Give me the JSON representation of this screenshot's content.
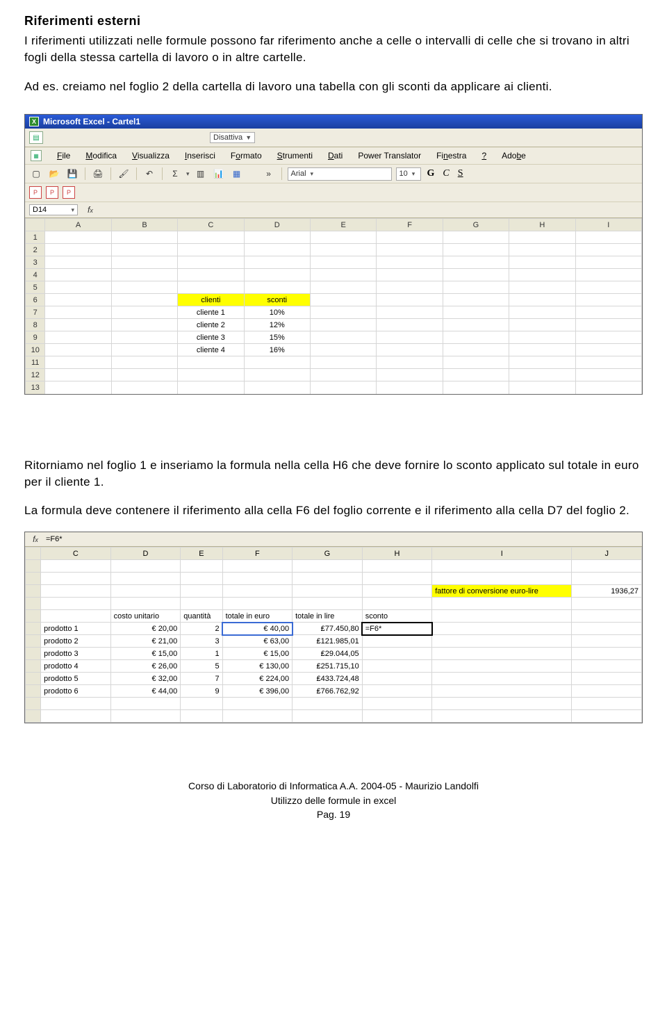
{
  "heading": "Riferimenti esterni",
  "para1": "I riferimenti utilizzati nelle formule possono far riferimento anche a celle o intervalli di celle che si trovano in altri fogli della stessa cartella di lavoro o in altre cartelle.",
  "para2": "Ad es. creiamo nel foglio 2 della cartella di lavoro una tabella con gli sconti da applicare ai clienti.",
  "para3": "Ritorniamo nel foglio 1 e inseriamo la formula nella cella H6 che deve fornire lo sconto applicato sul totale in euro per il cliente 1.",
  "para4": "La formula deve contenere il riferimento alla cella F6 del foglio corrente e il riferimento alla cella D7 del foglio 2.",
  "excel1": {
    "title": "Microsoft Excel - Cartel1",
    "disattiva": "Disattiva",
    "menus": [
      "File",
      "Modifica",
      "Visualizza",
      "Inserisci",
      "Formato",
      "Strumenti",
      "Dati",
      "Power Translator",
      "Finestra",
      "?",
      "Adobe"
    ],
    "font_name": "Arial",
    "font_size": "10",
    "namebox": "D14",
    "columns": [
      "A",
      "B",
      "C",
      "D",
      "E",
      "F",
      "G",
      "H",
      "I"
    ],
    "row_labels": [
      "1",
      "2",
      "3",
      "4",
      "5",
      "6",
      "7",
      "8",
      "9",
      "10",
      "11",
      "12",
      "13"
    ],
    "header_row": {
      "c": "clienti",
      "d": "sconti"
    },
    "rows": [
      {
        "c": "cliente 1",
        "d": "10%"
      },
      {
        "c": "cliente 2",
        "d": "12%"
      },
      {
        "c": "cliente 3",
        "d": "15%"
      },
      {
        "c": "cliente 4",
        "d": "16%"
      }
    ]
  },
  "excel2": {
    "formula": "=F6*",
    "columns": [
      "C",
      "D",
      "E",
      "F",
      "G",
      "H",
      "I",
      "J"
    ],
    "conv_label": "fattore di conversione euro-lire",
    "conv_value": "1936,27",
    "headers": {
      "d": "costo unitario",
      "e": "quantità",
      "f": "totale in euro",
      "g": "totale in lire",
      "h": "sconto"
    },
    "rows": [
      {
        "c": "prodotto 1",
        "d": "€ 20,00",
        "e": "2",
        "f": "€ 40,00",
        "g": "₤77.450,80",
        "h": "=F6*"
      },
      {
        "c": "prodotto 2",
        "d": "€ 21,00",
        "e": "3",
        "f": "€ 63,00",
        "g": "₤121.985,01",
        "h": ""
      },
      {
        "c": "prodotto 3",
        "d": "€ 15,00",
        "e": "1",
        "f": "€ 15,00",
        "g": "₤29.044,05",
        "h": ""
      },
      {
        "c": "prodotto 4",
        "d": "€ 26,00",
        "e": "5",
        "f": "€ 130,00",
        "g": "₤251.715,10",
        "h": ""
      },
      {
        "c": "prodotto 5",
        "d": "€ 32,00",
        "e": "7",
        "f": "€ 224,00",
        "g": "₤433.724,48",
        "h": ""
      },
      {
        "c": "prodotto 6",
        "d": "€ 44,00",
        "e": "9",
        "f": "€ 396,00",
        "g": "₤766.762,92",
        "h": ""
      }
    ]
  },
  "footer": {
    "l1": "Corso di Laboratorio di Informatica A.A. 2004-05 - Maurizio Landolfi",
    "l2": "Utilizzo delle formule in excel",
    "l3": "Pag. 19"
  }
}
